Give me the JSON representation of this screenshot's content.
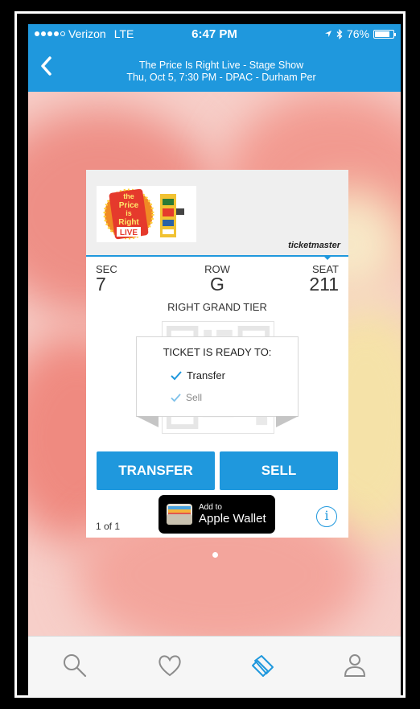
{
  "status_bar": {
    "carrier": "Verizon",
    "network": "LTE",
    "time": "6:47 PM",
    "battery": "76%",
    "battery_level": 0.76
  },
  "header": {
    "title_line1": "The Price Is Right Live - Stage Show",
    "title_line2": "Thu, Oct 5, 7:30 PM - DPAC - Durham Per"
  },
  "ticket": {
    "logo_lines": [
      "the",
      "Price",
      "is",
      "Right",
      "LIVE"
    ],
    "brand": "ticketmaster",
    "sec_label": "SEC",
    "sec": "7",
    "row_label": "ROW",
    "row": "G",
    "seat_label": "SEAT",
    "seat": "211",
    "tier": "RIGHT GRAND TIER",
    "ready_title": "TICKET IS READY TO:",
    "ready_options": [
      "Transfer",
      "Sell"
    ],
    "transfer_button": "TRANSFER",
    "sell_button": "SELL",
    "pager": "1 of 1",
    "wallet_small": "Add to",
    "wallet_big": "Apple Wallet",
    "info_glyph": "i"
  },
  "colors": {
    "accent": "#1f98dd",
    "background_blur": "#f7cfc9"
  },
  "tabs": [
    "search-icon",
    "heart-icon",
    "tickets-icon",
    "account-icon"
  ]
}
